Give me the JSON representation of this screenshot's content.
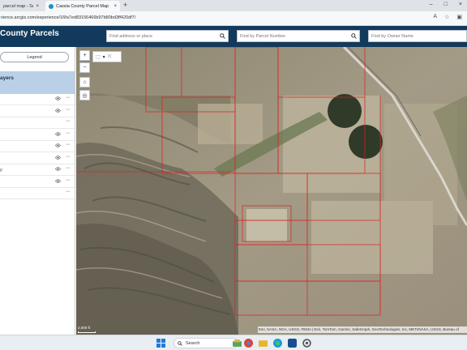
{
  "browser": {
    "tabs": [
      {
        "title": "parcel map - Search",
        "active": false
      },
      {
        "title": "Cassia County Parcel Map",
        "active": true
      }
    ],
    "url": "rience.arcgis.com/experience/16fa7ed83156466b97b80bd3ff420df7/"
  },
  "app": {
    "title": "County Parcels",
    "search": {
      "address_placeholder": "Find address or place",
      "parcel_placeholder": "Find by Parcel Number",
      "owner_placeholder": "Find by Owner Name"
    },
    "header_color": "#123a5c"
  },
  "panel": {
    "legend_label": "Legend",
    "layers_title": "ayers",
    "layers": [
      {
        "name": "",
        "visible_toggle": true
      },
      {
        "name": "",
        "visible_toggle": true
      },
      {
        "name": "",
        "visible_toggle": false
      },
      {
        "name": "",
        "visible_toggle": true
      },
      {
        "name": "",
        "visible_toggle": true
      },
      {
        "name": "",
        "visible_toggle": true
      },
      {
        "name": "y",
        "visible_toggle": true
      },
      {
        "name": "",
        "visible_toggle": true
      },
      {
        "name": "",
        "visible_toggle": false
      }
    ]
  },
  "map": {
    "scale_label": "2,000 ft",
    "attribution": "Esri, NASA, NGA, USGS, FEMA | Esri, TomTom, Garmin, SafeGraph, GeoTechnologies, Inc, METI/NASA, USGS, Bureau of",
    "parcel_line_color": "#e02020"
  },
  "taskbar": {
    "search_label": "Search"
  }
}
